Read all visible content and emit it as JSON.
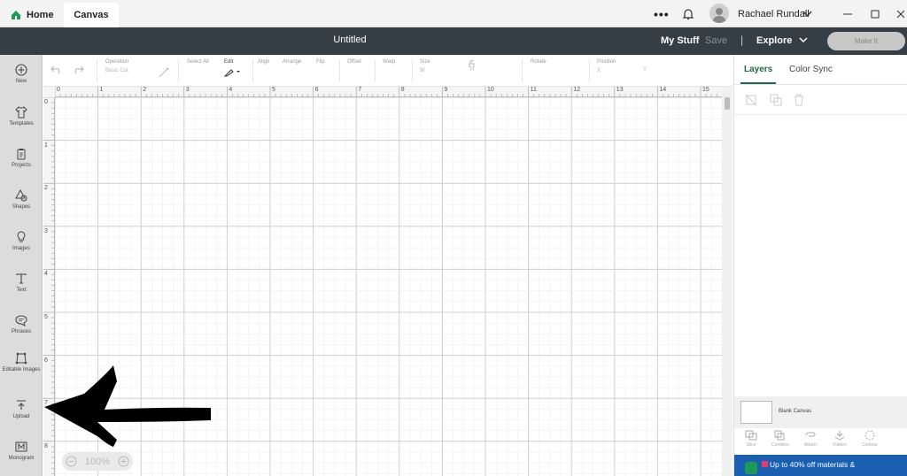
{
  "titlebar": {
    "tabs": [
      {
        "label": "Home",
        "icon": "home-icon"
      },
      {
        "label": "Canvas"
      }
    ],
    "more": "•••",
    "user_name": "Rachael Rundall"
  },
  "header": {
    "title": "Untitled",
    "my_stuff": "My Stuff",
    "save": "Save",
    "explore": "Explore",
    "make_it": "Make It"
  },
  "sidebar": {
    "items": [
      {
        "label": "New",
        "icon": "plus-circle-icon"
      },
      {
        "label": "Templates",
        "icon": "shirt-icon"
      },
      {
        "label": "Projects",
        "icon": "clipboard-icon"
      },
      {
        "label": "Shapes",
        "icon": "shapes-icon"
      },
      {
        "label": "Images",
        "icon": "bulb-icon"
      },
      {
        "label": "Text",
        "icon": "text-icon"
      },
      {
        "label": "Phrases",
        "icon": "speech-bubble-icon"
      },
      {
        "label": "Editable Images",
        "icon": "editable-images-icon"
      },
      {
        "label": "Upload",
        "icon": "upload-icon"
      },
      {
        "label": "Monogram",
        "icon": "monogram-icon"
      }
    ]
  },
  "toolbar": {
    "operation": {
      "label": "Operation",
      "value": "Basic Cut"
    },
    "select_all": "Select All",
    "edit": "Edit",
    "align": "Align",
    "arrange": "Arrange",
    "flip": "Flip",
    "offset": "Offset",
    "warp": "Warp",
    "size": {
      "label": "Size",
      "w": "W",
      "h": "H"
    },
    "rotate": "Rotate",
    "position": {
      "label": "Position",
      "x": "X",
      "y": "Y"
    }
  },
  "ruler": {
    "top": [
      "0",
      "1",
      "2",
      "3",
      "4",
      "5",
      "6",
      "7",
      "8",
      "9",
      "10",
      "11",
      "12",
      "13",
      "14",
      "15"
    ],
    "left": [
      "0",
      "1",
      "2",
      "3",
      "4",
      "5",
      "6",
      "7",
      "8"
    ]
  },
  "zoom": {
    "value": "100%"
  },
  "panel": {
    "tabs": [
      "Layers",
      "Color Sync"
    ],
    "blank_canvas": "Blank Canvas",
    "actions": [
      "Slice",
      "Combine",
      "Attach",
      "Flatten",
      "Contour"
    ],
    "promo": "Up to 40% off materials &"
  },
  "colors": {
    "accent": "#1d6b4a",
    "header_bg": "#353d45",
    "promo_bg": "#1a5fb0"
  }
}
